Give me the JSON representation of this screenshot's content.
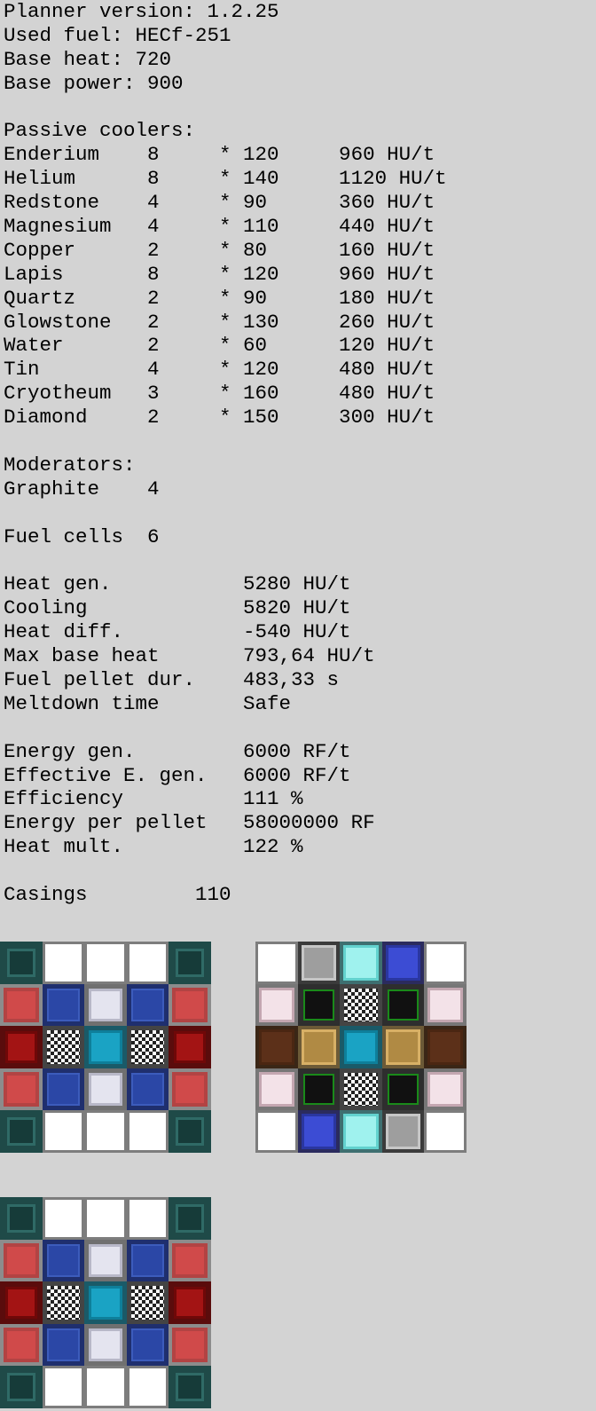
{
  "report": {
    "lines": [
      "Planner version: 1.2.25",
      "Used fuel: HECf-251",
      "Base heat: 720",
      "Base power: 900",
      "",
      "Passive coolers:",
      "Enderium    8     * 120     960 HU/t",
      "Helium      8     * 140     1120 HU/t",
      "Redstone    4     * 90      360 HU/t",
      "Magnesium   4     * 110     440 HU/t",
      "Copper      2     * 80      160 HU/t",
      "Lapis       8     * 120     960 HU/t",
      "Quartz      2     * 90      180 HU/t",
      "Glowstone   2     * 130     260 HU/t",
      "Water       2     * 60      120 HU/t",
      "Tin         4     * 120     480 HU/t",
      "Cryotheum   3     * 160     480 HU/t",
      "Diamond     2     * 150     300 HU/t",
      "",
      "Moderators:",
      "Graphite    4",
      "",
      "Fuel cells  6",
      "",
      "Heat gen.           5280 HU/t",
      "Cooling             5820 HU/t",
      "Heat diff.          -540 HU/t",
      "Max base heat       793,64 HU/t",
      "Fuel pellet dur.    483,33 s",
      "Meltdown time       Safe",
      "",
      "Energy gen.         6000 RF/t",
      "Effective E. gen.   6000 RF/t",
      "Efficiency          111 %",
      "Energy per pellet   58000000 RF",
      "Heat mult.          122 %",
      "",
      "Casings         110"
    ]
  },
  "layers": [
    {
      "name": "layer-1",
      "cells": [
        "casing-corner",
        "empty",
        "empty",
        "empty",
        "casing-corner",
        "redstone",
        "lapis",
        "quartz",
        "lapis",
        "redstone",
        "redcell",
        "checker",
        "diamondcell",
        "checker",
        "redcell",
        "redstone",
        "lapis",
        "quartz",
        "lapis",
        "redstone",
        "casing-corner",
        "empty",
        "empty",
        "empty",
        "casing-corner"
      ]
    },
    {
      "name": "layer-2",
      "cells": [
        "empty-plain",
        "water",
        "cryotheum",
        "tin",
        "empty-plain",
        "magnesium",
        "graphite",
        "checker",
        "graphite",
        "magnesium",
        "copper",
        "glowstone",
        "diamondcell",
        "glowstone",
        "copper",
        "magnesium",
        "graphite",
        "checker",
        "graphite",
        "magnesium",
        "empty-plain",
        "tin",
        "cryotheum",
        "water",
        "empty-plain"
      ]
    },
    {
      "name": "layer-3",
      "cells": [
        "casing-corner",
        "empty",
        "empty",
        "empty",
        "casing-corner",
        "redstone",
        "lapis",
        "quartz",
        "lapis",
        "redstone",
        "redcell",
        "checker",
        "diamondcell",
        "checker",
        "redcell",
        "redstone",
        "lapis",
        "quartz",
        "lapis",
        "redstone",
        "casing-corner",
        "empty",
        "empty",
        "empty",
        "casing-corner"
      ]
    }
  ]
}
